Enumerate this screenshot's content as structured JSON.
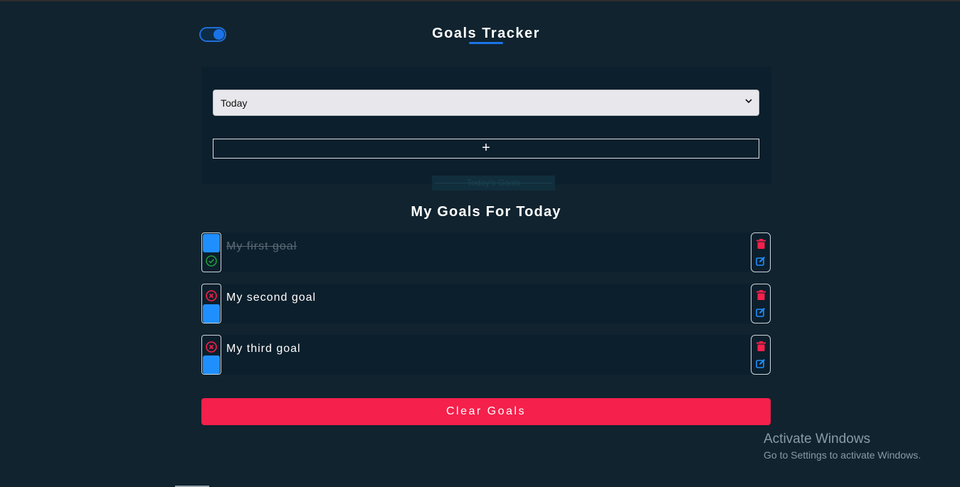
{
  "header": {
    "title": "Goals Tracker",
    "theme_toggle_on": true
  },
  "form": {
    "period_select": {
      "selected": "Today"
    },
    "add_button_label": "+",
    "faded_label": "Today's Goals"
  },
  "goals_section": {
    "title": "My Goals For Today",
    "goals": [
      {
        "text": "My first goal",
        "completed": true
      },
      {
        "text": "My second goal",
        "completed": false
      },
      {
        "text": "My third goal",
        "completed": false
      }
    ]
  },
  "clear_button_label": "Clear Goals",
  "watermark": {
    "title": "Activate Windows",
    "subtitle": "Go to Settings to activate Windows."
  },
  "colors": {
    "background": "#10232f",
    "panel": "#0c1f2c",
    "accent_blue": "#1a73e8",
    "danger": "#f5204b",
    "success": "#1f9d3a"
  }
}
